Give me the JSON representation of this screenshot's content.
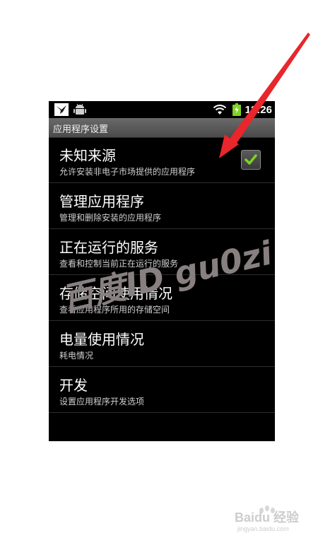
{
  "status_bar": {
    "time": "12:26",
    "icons": [
      "notification-bird-icon",
      "android-debug-icon",
      "wifi-icon",
      "battery-icon"
    ]
  },
  "title_bar": {
    "title": "应用程序设置"
  },
  "settings": {
    "items": [
      {
        "title": "未知来源",
        "subtitle": "允许安装非电子市场提供的应用程序",
        "checked": true
      },
      {
        "title": "管理应用程序",
        "subtitle": "管理和删除安装的应用程序"
      },
      {
        "title": "正在运行的服务",
        "subtitle": "查看和控制当前正在运行的服务"
      },
      {
        "title": "存储空间使用情况",
        "subtitle": "查看应用程序所用的存储空间"
      },
      {
        "title": "电量使用情况",
        "subtitle": "耗电情况"
      },
      {
        "title": "开发",
        "subtitle": "设置应用程序开发选项"
      }
    ]
  },
  "watermark": {
    "text": "百度ID gu0zi"
  },
  "baidu_mark": {
    "brand": "Baidu 经验",
    "url": "jingyan.baidu.com"
  },
  "colors": {
    "arrow": "#e8262b",
    "check": "#7ed321",
    "battery": "#7ed321"
  }
}
